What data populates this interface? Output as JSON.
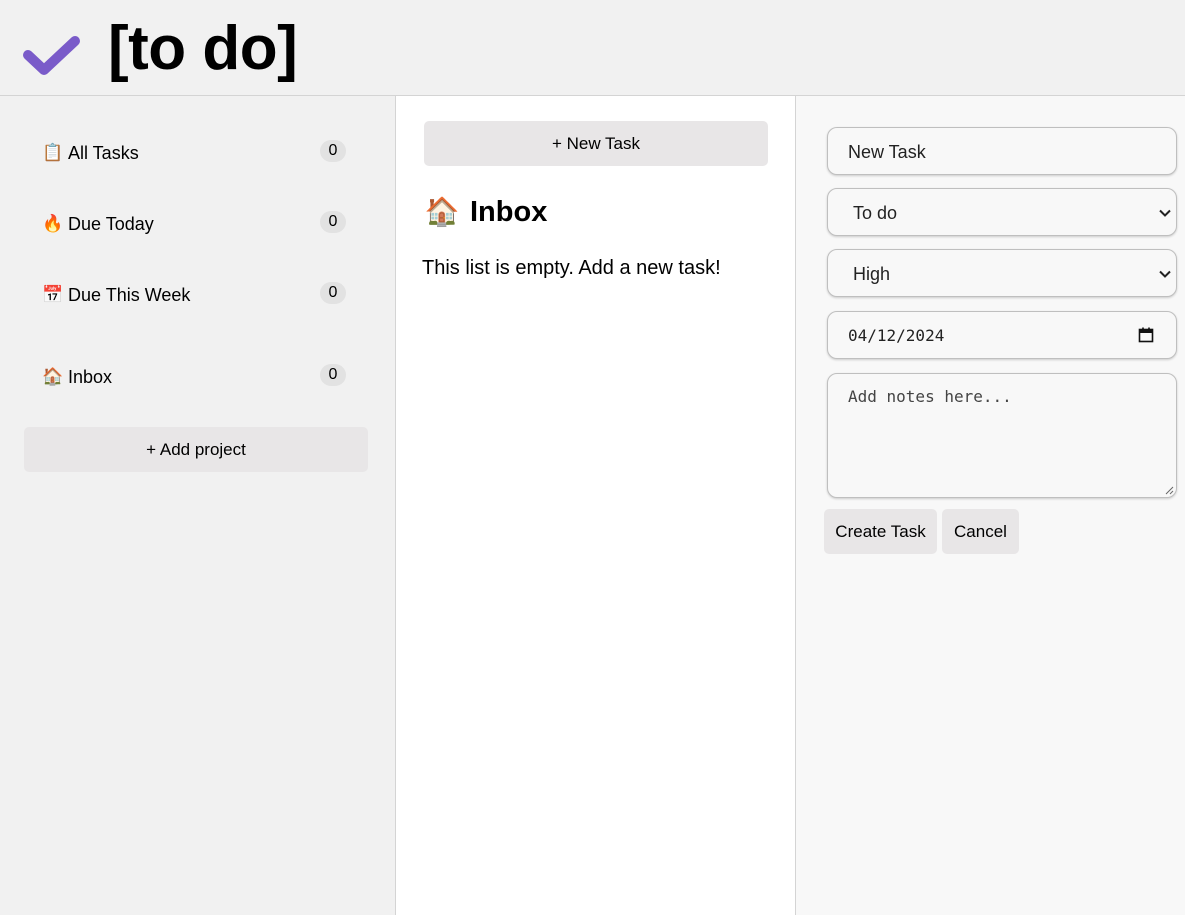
{
  "header": {
    "title": "[to do]",
    "logo_icon": "checkmark-icon",
    "logo_color": "#7a5bc9"
  },
  "sidebar": {
    "items": [
      {
        "emoji": "📋",
        "icon": "clipboard-icon",
        "label": "All Tasks",
        "count": "0"
      },
      {
        "emoji": "🔥",
        "icon": "fire-icon",
        "label": "Due Today",
        "count": "0"
      },
      {
        "emoji": "📅",
        "icon": "calendar-icon",
        "label": "Due This Week",
        "count": "0"
      },
      {
        "emoji": "🏠",
        "icon": "house-icon",
        "label": "Inbox",
        "count": "0"
      }
    ],
    "add_project_label": "+ Add project"
  },
  "main": {
    "new_task_label": "+ New Task",
    "list_emoji": "🏠",
    "list_icon": "house-icon",
    "list_title": "Inbox",
    "empty_message": "This list is empty. Add a new task!"
  },
  "form": {
    "title_value": "New Task",
    "status_selected": "To do",
    "priority_selected": "High",
    "date_value": "04/12/2024",
    "notes_placeholder": "Add notes here...",
    "create_label": "Create Task",
    "cancel_label": "Cancel"
  }
}
